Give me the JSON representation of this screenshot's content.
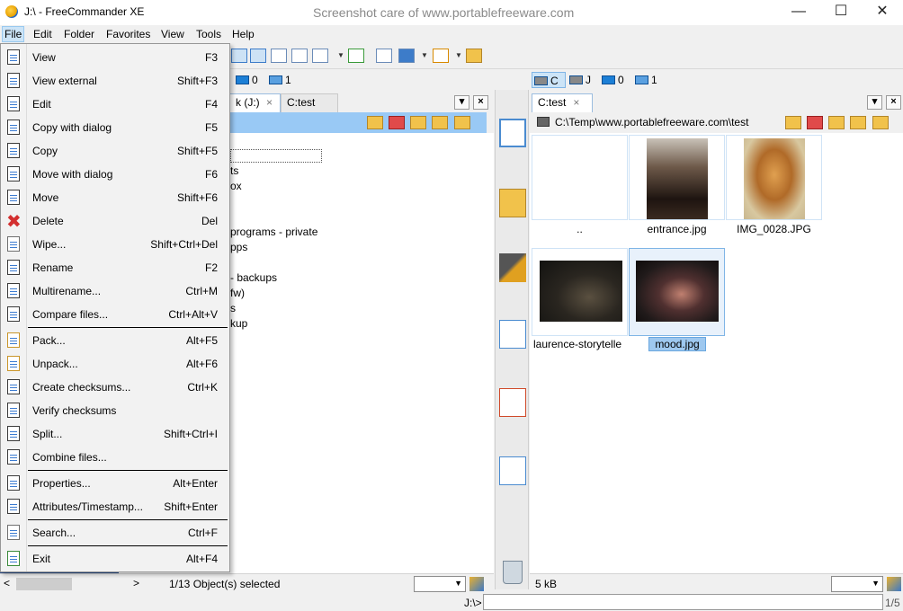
{
  "window": {
    "title": "J:\\ - FreeCommander XE",
    "watermark": "Screenshot care of www.portablefreeware.com",
    "minimize_icon": "minimize-icon",
    "maximize_icon": "maximize-icon",
    "close_icon": "close-icon"
  },
  "menubar": {
    "items": [
      "File",
      "Edit",
      "Folder",
      "Favorites",
      "View",
      "Tools",
      "Help"
    ],
    "active": "File"
  },
  "left_drives": {
    "items": [
      {
        "label": "0",
        "icon": "network-drive-icon"
      },
      {
        "label": "1",
        "icon": "cloud-drive-icon"
      }
    ]
  },
  "right_drives": {
    "items": [
      {
        "label": "C",
        "icon": "hard-drive-icon",
        "selected": true
      },
      {
        "label": "J",
        "icon": "hard-drive-icon"
      },
      {
        "label": "0",
        "icon": "network-drive-icon"
      },
      {
        "label": "1",
        "icon": "cloud-drive-icon"
      }
    ]
  },
  "left_tabs": [
    {
      "label": "k (J:)",
      "active": true,
      "close": "×"
    },
    {
      "label": "C:test",
      "active": false
    }
  ],
  "right_tabs": [
    {
      "label": "C:test",
      "active": true,
      "close": "×"
    }
  ],
  "tab_buttons": {
    "dropdown": "▾",
    "close": "×"
  },
  "right_path": "C:\\Temp\\www.portablefreeware.com\\test",
  "left_tree": {
    "lines": [
      "ts",
      "ox",
      "programs - private",
      "pps",
      "- backups",
      "fw)",
      "s",
      "kup"
    ]
  },
  "right_files": [
    {
      "name": "..",
      "kind": "parent"
    },
    {
      "name": "entrance.jpg",
      "kind": "image"
    },
    {
      "name": "IMG_0028.JPG",
      "kind": "image"
    },
    {
      "name": "laurence-storytelle",
      "kind": "image"
    },
    {
      "name": "mood.jpg",
      "kind": "image",
      "selected": true
    }
  ],
  "left_status": {
    "text": "1/13 Object(s) selected",
    "scroll_left": "<",
    "scroll_right": ">"
  },
  "right_status": {
    "text": "5 kB"
  },
  "cmdline": {
    "prompt": "J:\\>",
    "right_text": "1/5"
  },
  "file_menu": {
    "groups": [
      [
        {
          "label": "View",
          "shortcut": "F3",
          "icon": "view-icon"
        },
        {
          "label": "View external",
          "shortcut": "Shift+F3",
          "icon": "view-external-icon"
        },
        {
          "label": "Edit",
          "shortcut": "F4",
          "icon": "edit-icon"
        },
        {
          "label": "Copy with dialog",
          "shortcut": "F5",
          "icon": "copy-with-dialog-icon"
        },
        {
          "label": "Copy",
          "shortcut": "Shift+F5",
          "icon": "copy-icon"
        },
        {
          "label": "Move with dialog",
          "shortcut": "F6",
          "icon": "move-with-dialog-icon"
        },
        {
          "label": "Move",
          "shortcut": "Shift+F6",
          "icon": "move-icon"
        },
        {
          "label": "Delete",
          "shortcut": "Del",
          "icon": "delete-icon"
        },
        {
          "label": "Wipe...",
          "shortcut": "Shift+Ctrl+Del",
          "icon": "wipe-icon"
        },
        {
          "label": "Rename",
          "shortcut": "F2",
          "icon": "rename-icon"
        },
        {
          "label": "Multirename...",
          "shortcut": "Ctrl+M",
          "icon": "multirename-icon"
        },
        {
          "label": "Compare files...",
          "shortcut": "Ctrl+Alt+V",
          "icon": "compare-files-icon"
        }
      ],
      [
        {
          "label": "Pack...",
          "shortcut": "Alt+F5",
          "icon": "pack-icon"
        },
        {
          "label": "Unpack...",
          "shortcut": "Alt+F6",
          "icon": "unpack-icon"
        },
        {
          "label": "Create checksums...",
          "shortcut": "Ctrl+K",
          "icon": "checksum-icon"
        },
        {
          "label": "Verify checksums",
          "shortcut": "",
          "icon": "verify-checksum-icon"
        },
        {
          "label": "Split...",
          "shortcut": "Shift+Ctrl+I",
          "icon": "split-icon"
        },
        {
          "label": "Combine files...",
          "shortcut": "",
          "icon": "combine-files-icon"
        }
      ],
      [
        {
          "label": "Properties...",
          "shortcut": "Alt+Enter",
          "icon": "properties-icon"
        },
        {
          "label": "Attributes/Timestamp...",
          "shortcut": "Shift+Enter",
          "icon": "attributes-icon"
        }
      ],
      [
        {
          "label": "Search...",
          "shortcut": "Ctrl+F",
          "icon": "search-icon"
        }
      ],
      [
        {
          "label": "Exit",
          "shortcut": "Alt+F4",
          "icon": "exit-icon"
        }
      ]
    ]
  },
  "colors": {
    "accent": "#3d7cc9",
    "menu_highlight": "#cce4f7",
    "path_bar_left": "#99c9f5",
    "delete_red": "#d32f2f"
  }
}
